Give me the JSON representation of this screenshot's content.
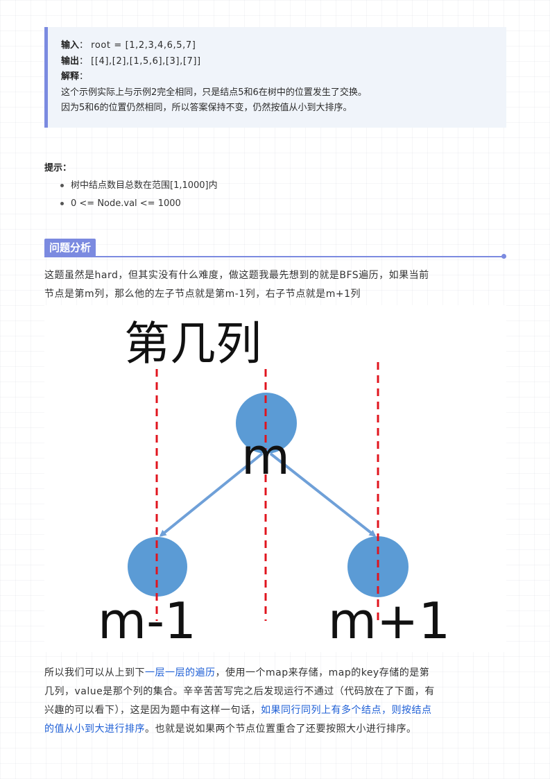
{
  "example": {
    "input_label": "输入",
    "input_value": "root = [1,2,3,4,6,5,7]",
    "output_label": "输出",
    "output_value": "[[4],[2],[1,5,6],[3],[7]]",
    "explain_label": "解释",
    "explain_line1": "这个示例实际上与示例2完全相同，只是结点5和6在树中的位置发生了交换。",
    "explain_line2": "因为5和6的位置仍然相同，所以答案保持不变，仍然按值从小到大排序。"
  },
  "hints": {
    "title": "提示：",
    "items": [
      "树中结点数目总数在范围[1,1000]内",
      "0 <= Node.val <= 1000"
    ]
  },
  "section": {
    "title": "问题分析"
  },
  "para1": {
    "line1": "这题虽然是hard，但其实没有什么难度，做这题我最先想到的就是BFS遍历，如果当前",
    "line2": "节点是第m列，那么他的左子节点就是第m-1列，右子节点就是m+1列"
  },
  "figure": {
    "title": "第几列",
    "root_label": "m",
    "left_label": "m-1",
    "right_label": "m+1",
    "node_color": "#5b9bd5",
    "guide_color": "#e0141e"
  },
  "para2": {
    "l1_a": "所以我们可以从上到下",
    "l1_link": "一层一层的遍历",
    "l1_b": "，使用一个map来存储，map的key存储的是第",
    "l2": "几列，value是那个列的集合。辛辛苦苦写完之后发现运行不通过（代码放在了下面，有",
    "l3_a": "兴趣的可以看下），这是因为题中有这样一句话，",
    "l3_link": "如果同行同列上有多个结点，则按结点",
    "l4_link": "的值从小到大进行排序",
    "l4_b": "。也就是说如果两个节点位置重合了还要按照大小进行排序。"
  }
}
